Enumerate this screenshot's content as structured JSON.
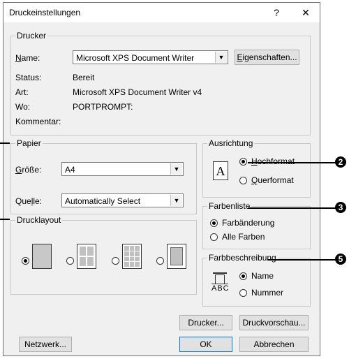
{
  "window": {
    "title": "Druckeinstellungen",
    "help": "?",
    "close": "✕"
  },
  "printer": {
    "group": "Drucker",
    "name_label": "Name:",
    "name_value": "Microsoft XPS Document Writer",
    "properties_button": "Eigenschaften...",
    "status_label": "Status:",
    "status_value": "Bereit",
    "type_label": "Art:",
    "type_value": "Microsoft XPS Document Writer v4",
    "where_label": "Wo:",
    "where_value": "PORTPROMPT:",
    "comment_label": "Kommentar:"
  },
  "paper": {
    "group": "Papier",
    "size_label": "Größe:",
    "size_value": "A4",
    "source_label": "Quelle:",
    "source_value": "Automatically Select"
  },
  "orientation": {
    "group": "Ausrichtung",
    "portrait": "Hochformat",
    "landscape": "Querformat",
    "selected": "portrait",
    "icon_letter": "A"
  },
  "color_list": {
    "group": "Farbenliste",
    "option1": "Farbänderung",
    "option2": "Alle Farben",
    "selected": "option1"
  },
  "layout": {
    "group": "Drucklayout",
    "selected_index": 0
  },
  "color_desc": {
    "group": "Farbbeschreibung",
    "option1": "Name",
    "option2": "Nummer",
    "icon_text": "ABC",
    "selected": "option1"
  },
  "buttons": {
    "printer": "Drucker...",
    "preview": "Druckvorschau...",
    "network": "Netzwerk...",
    "ok": "OK",
    "cancel": "Abbrechen"
  },
  "callouts": [
    "2",
    "3",
    "5"
  ]
}
